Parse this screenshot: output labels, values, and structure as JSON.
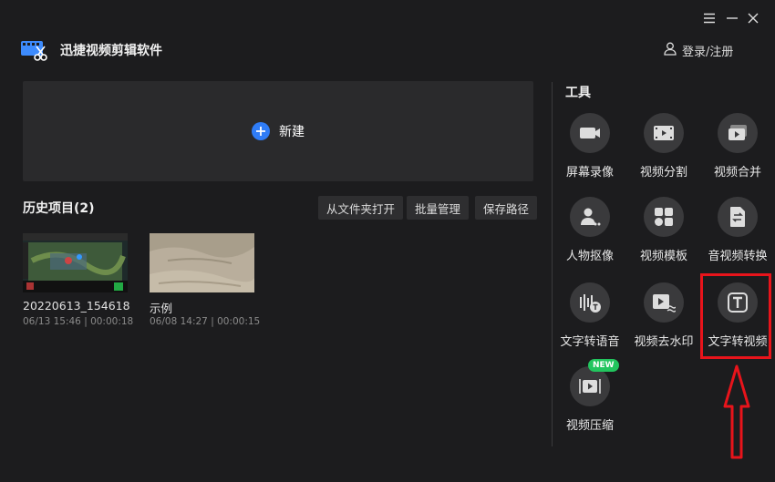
{
  "app": {
    "title": "迅捷视频剪辑软件"
  },
  "window": {
    "menu_icon": "menu-icon",
    "minimize_icon": "minimize-icon",
    "close_icon": "close-icon"
  },
  "header": {
    "login_label": "登录/注册",
    "login_icon": "user-icon"
  },
  "new_project": {
    "label": "新建",
    "icon": "plus-circle-icon"
  },
  "history": {
    "title": "历史项目(2)",
    "buttons": [
      "从文件夹打开",
      "批量管理",
      "保存路径"
    ],
    "projects": [
      {
        "name": "20220613_154618",
        "meta": "06/13 15:46 | 00:00:18"
      },
      {
        "name": "示例",
        "meta": "06/08 14:27 | 00:00:15"
      }
    ]
  },
  "tools": {
    "title": "工具",
    "items": [
      {
        "label": "屏幕录像",
        "icon": "screen-record-icon"
      },
      {
        "label": "视频分割",
        "icon": "video-split-icon"
      },
      {
        "label": "视频合并",
        "icon": "video-merge-icon"
      },
      {
        "label": "人物抠像",
        "icon": "person-cutout-icon"
      },
      {
        "label": "视频模板",
        "icon": "video-template-icon"
      },
      {
        "label": "音视频转换",
        "icon": "av-convert-icon"
      },
      {
        "label": "文字转语音",
        "icon": "text-to-speech-icon"
      },
      {
        "label": "视频去水印",
        "icon": "remove-watermark-icon"
      },
      {
        "label": "文字转视频",
        "icon": "text-to-video-icon"
      },
      {
        "label": "视频压缩",
        "icon": "video-compress-icon",
        "badge": "NEW"
      }
    ]
  },
  "colors": {
    "background": "#1c1c1e",
    "panel": "#2a2a2c",
    "accent": "#2f7cf6",
    "highlight": "#e8141b",
    "badge": "#22c55e"
  }
}
